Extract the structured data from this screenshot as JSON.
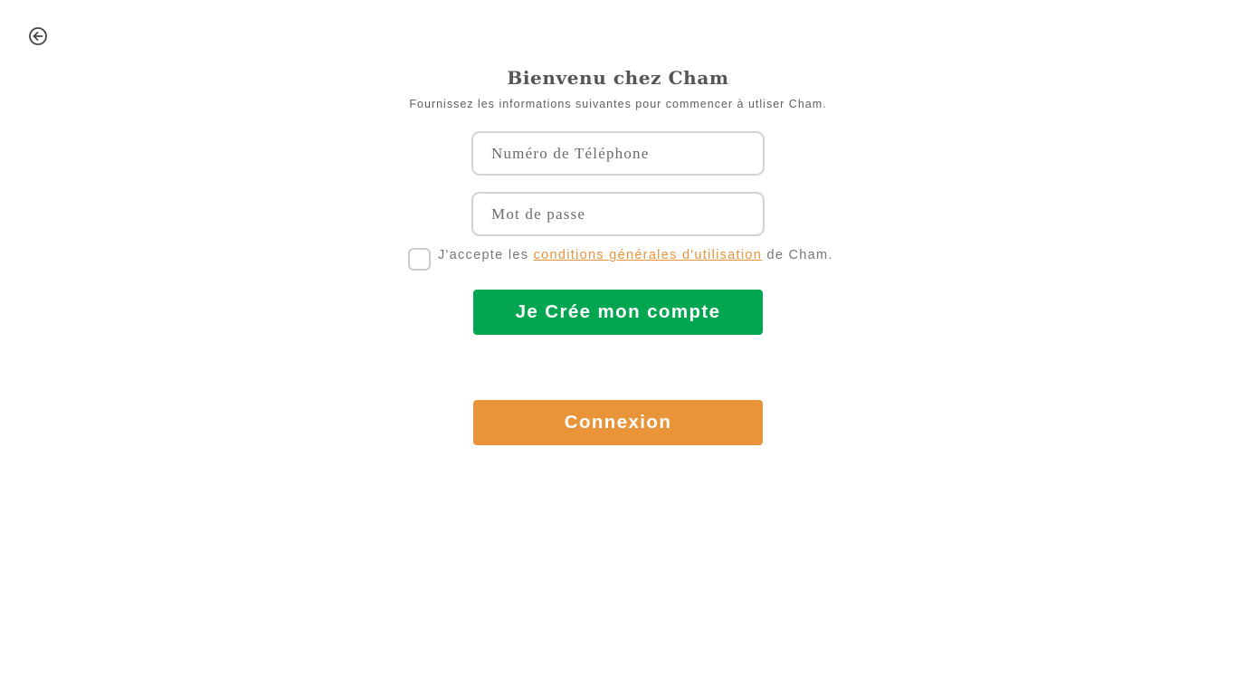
{
  "header": {
    "back_icon": "arrow-left-circle-icon",
    "title": "Bienvenu chez Cham",
    "subtitle": "Fournissez les informations suivantes pour commencer à utliser Cham."
  },
  "form": {
    "phone_placeholder": "Numéro de Téléphone",
    "phone_value": "",
    "password_placeholder": "Mot de passe",
    "password_value": "",
    "terms_checked": false,
    "terms_prefix": "J'accepte les ",
    "terms_link": "conditions générales d'utilisation",
    "terms_suffix": " de Cham.",
    "create_button": "Je Crée mon compte",
    "login_button": "Connexion"
  },
  "colors": {
    "primary_green": "#02a650",
    "accent_orange": "#ea943a",
    "text_gray": "#555555"
  }
}
